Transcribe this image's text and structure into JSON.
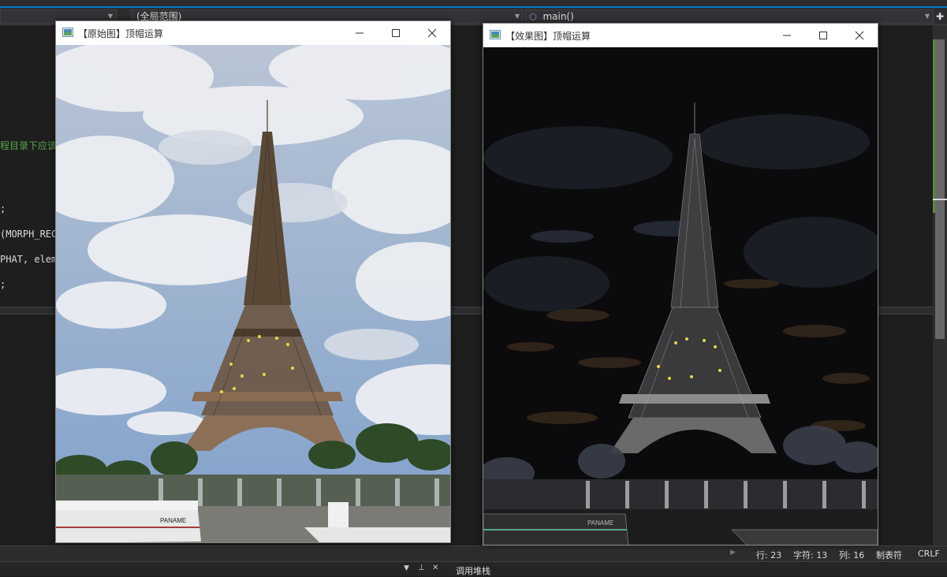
{
  "nav": {
    "scope_label": "(全局范围)",
    "function_label": "main()"
  },
  "code_lines": [
    "程目录下应该",
    ";",
    "(MORPH_REC",
    "PHAT, eleme",
    ";"
  ],
  "windows": {
    "original": {
      "title": "【原始图】顶帽运算"
    },
    "result": {
      "title": "【效果图】顶帽运算"
    }
  },
  "image_text": {
    "boat_name": "PANAME"
  },
  "status": {
    "line": "行: 23",
    "char": "字符: 13",
    "col": "列: 16",
    "tabs": "制表符",
    "eol": "CRLF"
  },
  "bottom_panel": {
    "label": "调用堆栈"
  },
  "colors": {
    "accent": "#007acc",
    "code_comment": "#57a64a",
    "code_text": "#dcdcdc",
    "function_icon": "#b180d7"
  },
  "icons": {
    "minimize": "minimize-icon",
    "maximize": "maximize-icon",
    "close": "close-icon"
  }
}
